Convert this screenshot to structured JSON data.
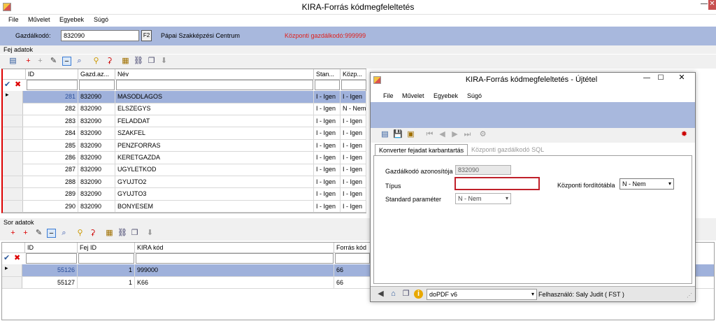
{
  "window": {
    "title": "KIRA-Forrás kódmegfeleltetés",
    "min": "—",
    "close": "✕"
  },
  "menu": [
    "File",
    "Művelet",
    "Egyebek",
    "Súgó"
  ],
  "header": {
    "gazd_label": "Gazdálkodó:",
    "gazd_value": "832090",
    "f2": "F2",
    "org_name": "Pápai Szakképzési Centrum",
    "kozponti": "Központi gazdálkodó:999999"
  },
  "fej": {
    "section": "Fej adatok",
    "cols": [
      "ID",
      "Gazd.az...",
      "Név",
      "Stan...",
      "Közp..."
    ],
    "rows": [
      [
        "281",
        "832090",
        "MASODLAGOS",
        "I - Igen",
        "I - Igen"
      ],
      [
        "282",
        "832090",
        "ELSZEGYS",
        "I - Igen",
        "N - Nem"
      ],
      [
        "283",
        "832090",
        "FELADDAT",
        "I - Igen",
        "I - Igen"
      ],
      [
        "284",
        "832090",
        "SZAKFEL",
        "I - Igen",
        "I - Igen"
      ],
      [
        "285",
        "832090",
        "PENZFORRAS",
        "I - Igen",
        "I - Igen"
      ],
      [
        "286",
        "832090",
        "KERETGAZDA",
        "I - Igen",
        "I - Igen"
      ],
      [
        "287",
        "832090",
        "UGYLETKOD",
        "I - Igen",
        "I - Igen"
      ],
      [
        "288",
        "832090",
        "GYUJTO2",
        "I - Igen",
        "I - Igen"
      ],
      [
        "289",
        "832090",
        "GYUJTO3",
        "I - Igen",
        "I - Igen"
      ],
      [
        "290",
        "832090",
        "BONYESEM",
        "I - Igen",
        "I - Igen"
      ]
    ]
  },
  "sor": {
    "section": "Sor adatok",
    "cols": [
      "ID",
      "Fej ID",
      "KIRA kód",
      "Forrás kód"
    ],
    "rows": [
      [
        "55126",
        "1",
        "999000",
        "66"
      ],
      [
        "55127",
        "1",
        "K66",
        "66"
      ]
    ]
  },
  "dialog": {
    "title": "KIRA-Forrás kódmegfeleltetés  - Újtétel",
    "menu": [
      "File",
      "Művelet",
      "Egyebek",
      "Súgó"
    ],
    "tabs": [
      "Konverter fejadat karbantartás",
      "Központi gazdálkodó SQL"
    ],
    "fields": {
      "gazd_label": "Gazdálkodó azonosítója",
      "gazd_value": "832090",
      "tipus_label": "Típus",
      "tipus_value": "",
      "std_label": "Standard paraméter",
      "std_value": "N - Nem",
      "kozp_label": "Központi fordítótábla",
      "kozp_value": "N - Nem"
    },
    "status": {
      "printer": "doPDF v6",
      "user": "Felhasználó: Saly Judit ( FST )"
    }
  }
}
